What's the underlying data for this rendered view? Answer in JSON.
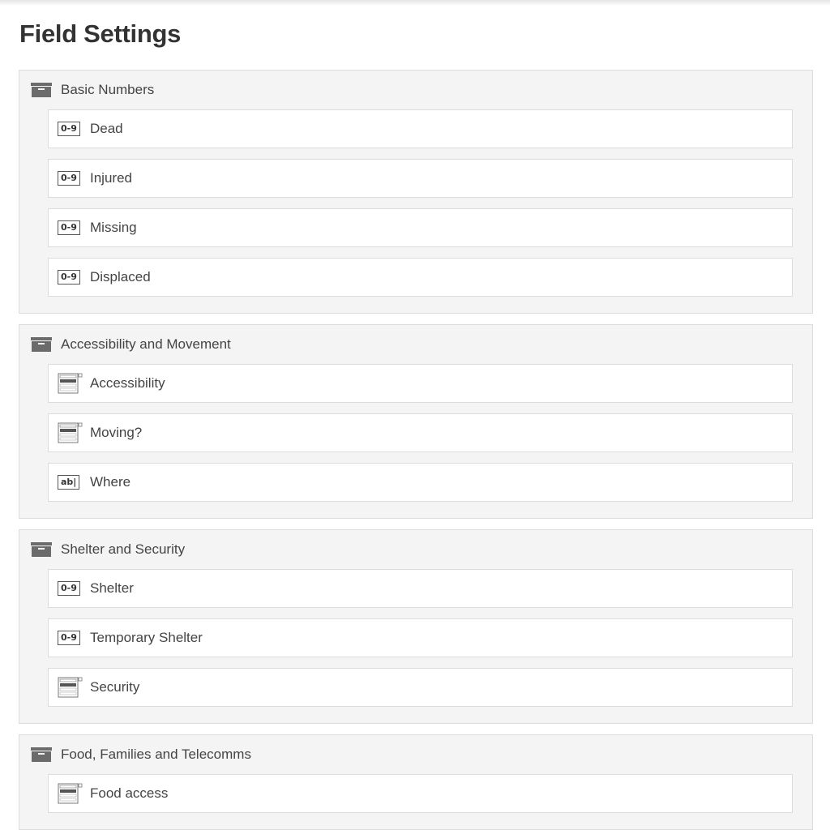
{
  "page": {
    "title": "Field Settings"
  },
  "icons": {
    "group": "box-icon",
    "number": "0-9",
    "select": "dropdown-list-icon",
    "text": "ab|"
  },
  "groups": [
    {
      "title": "Basic Numbers",
      "fields": [
        {
          "label": "Dead",
          "type": "number"
        },
        {
          "label": "Injured",
          "type": "number"
        },
        {
          "label": "Missing",
          "type": "number"
        },
        {
          "label": "Displaced",
          "type": "number"
        }
      ]
    },
    {
      "title": "Accessibility and Movement",
      "fields": [
        {
          "label": "Accessibility",
          "type": "select"
        },
        {
          "label": "Moving?",
          "type": "select"
        },
        {
          "label": "Where",
          "type": "text"
        }
      ]
    },
    {
      "title": "Shelter and Security",
      "fields": [
        {
          "label": "Shelter",
          "type": "number"
        },
        {
          "label": "Temporary Shelter",
          "type": "number"
        },
        {
          "label": "Security",
          "type": "select"
        }
      ]
    },
    {
      "title": "Food, Families and Telecomms",
      "fields": [
        {
          "label": "Food access",
          "type": "select"
        }
      ]
    }
  ]
}
